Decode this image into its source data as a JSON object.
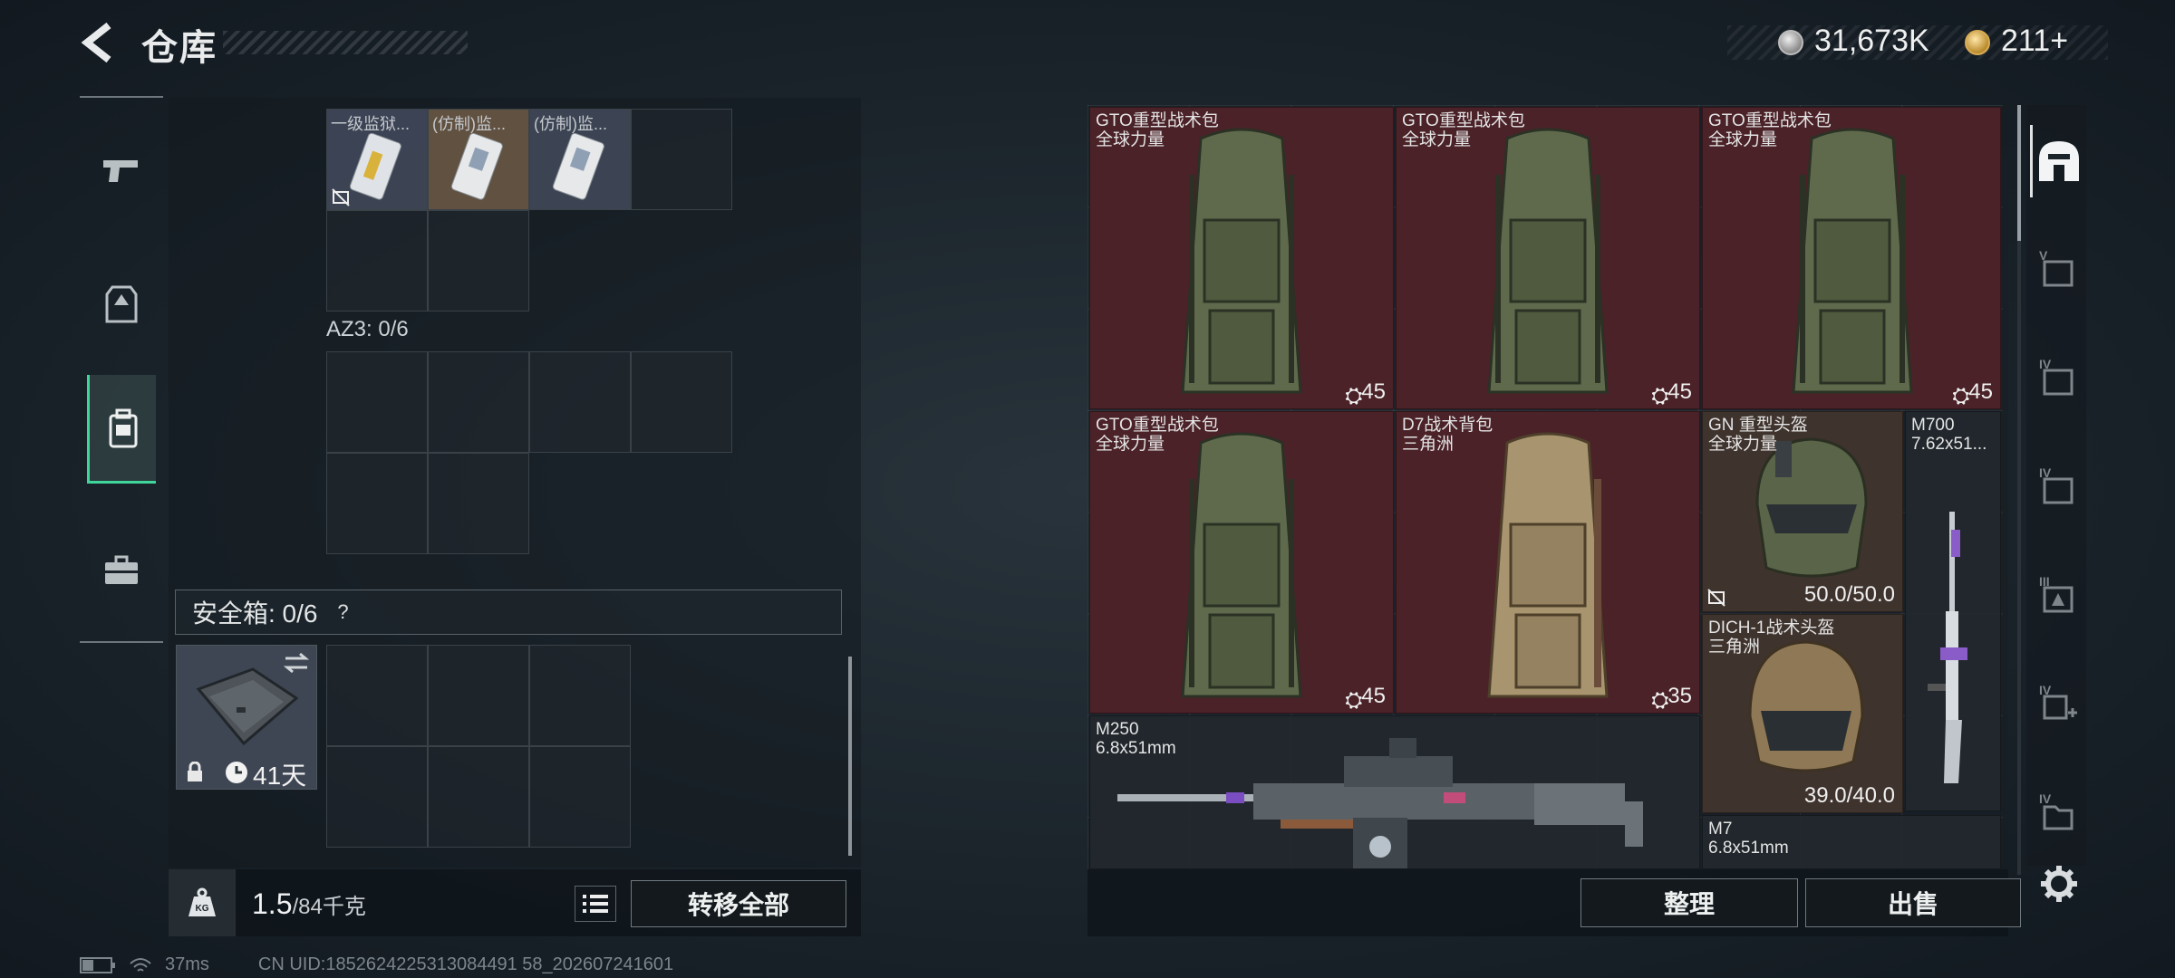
{
  "header": {
    "title": "仓库"
  },
  "currency": {
    "silver_amount": "31,673K",
    "gold_amount": "211+"
  },
  "left": {
    "top_items": [
      {
        "name": "一级监狱..."
      },
      {
        "name": "(仿制)监..."
      },
      {
        "name": "(仿制)监..."
      }
    ],
    "az3_label": "AZ3: 0/6",
    "safebox_label": "安全箱: 0/6",
    "safebox_duration": "41天",
    "weight_current": "1.5",
    "weight_max": "/84千克",
    "transfer_all": "转移全部"
  },
  "stash": {
    "items": [
      {
        "name": "GTO重型战术包",
        "sub": "全球力量",
        "count": "45"
      },
      {
        "name": "GTO重型战术包",
        "sub": "全球力量",
        "count": "45"
      },
      {
        "name": "GTO重型战术包",
        "sub": "全球力量",
        "count": "45"
      },
      {
        "name": "GTO重型战术包",
        "sub": "全球力量",
        "count": "45"
      },
      {
        "name": "D7战术背包",
        "sub": "三角洲",
        "count": "35"
      },
      {
        "name": "GN 重型头盔",
        "sub": "全球力量",
        "durability": "50.0/50.0"
      },
      {
        "name": "M700",
        "sub": "7.62x51..."
      },
      {
        "name": "DICH-1战术头盔",
        "sub": "三角洲",
        "durability": "39.0/40.0"
      },
      {
        "name": "M250",
        "sub": "6.8x51mm"
      },
      {
        "name": "M7",
        "sub": "6.8x51mm"
      }
    ],
    "sort_label": "整理",
    "sell_label": "出售"
  },
  "status": {
    "ping": "37ms",
    "uid": "CN UID:1852624225313084491 58_202607241601"
  },
  "colors": {
    "accent_green": "#3fd69b",
    "backpack_bg": "#4a2228",
    "helmet_bg": "#3f332d"
  }
}
